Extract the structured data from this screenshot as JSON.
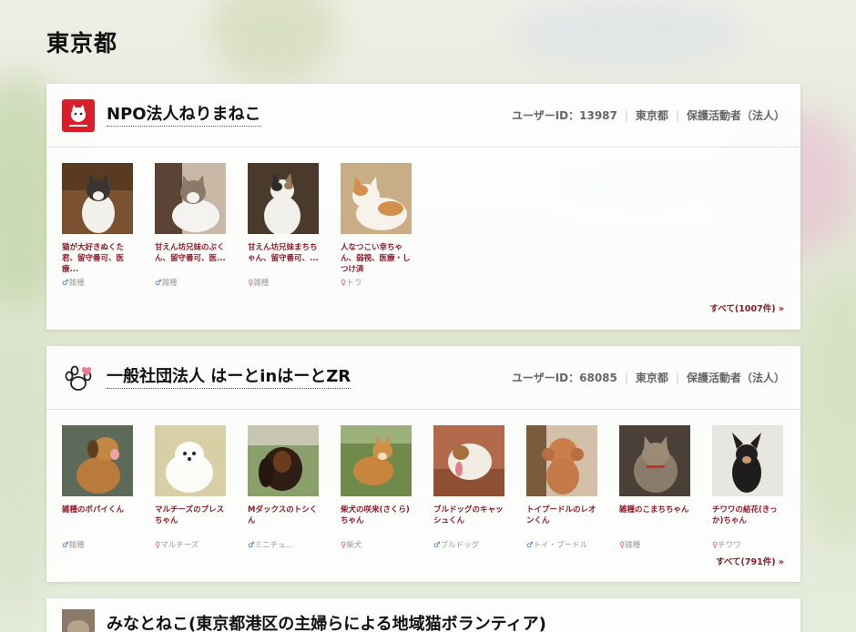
{
  "page": {
    "title": "東京都"
  },
  "orgs": [
    {
      "name": "NPO法人ねりまねこ",
      "user_id": "ユーザーID：13987",
      "area": "東京都",
      "type": "保護活動者（法人）",
      "all_link": "すべて(1007件) »",
      "icon": "nerimaneko-logo",
      "pets": [
        {
          "name": "猫が大好きぬくた君、留守番可、医療...",
          "sex": "♂",
          "breed": "雑種"
        },
        {
          "name": "甘えん坊兄妹のぶくん、留守番可、医...",
          "sex": "♂",
          "breed": "雑種"
        },
        {
          "name": "甘えん坊兄妹まちちゃん、留守番可、...",
          "sex": "♀",
          "breed": "雑種"
        },
        {
          "name": "人なつこい幸ちゃん、弱視、医療・しつけ済",
          "sex": "♀",
          "breed": "トラ"
        }
      ]
    },
    {
      "name": "一般社団法人 はーとinはーとZR",
      "user_id": "ユーザーID：68085",
      "area": "東京都",
      "type": "保護活動者（法人）",
      "all_link": "すべて(791件) »",
      "icon": "paw-heart-icon",
      "pets": [
        {
          "name": "雑種のポパイくん",
          "sex": "♂",
          "breed": "雑種"
        },
        {
          "name": "マルチーズのプレスちゃん",
          "sex": "♀",
          "breed": "マルチーズ"
        },
        {
          "name": "Mダックスのトシくん",
          "sex": "♂",
          "breed": "ミニチュ..."
        },
        {
          "name": "柴犬の咲来(さくら)ちゃん",
          "sex": "♀",
          "breed": "柴犬"
        },
        {
          "name": "ブルドッグのキャッシュくん",
          "sex": "♂",
          "breed": "ブルドッグ"
        },
        {
          "name": "トイプードルのレオンくん",
          "sex": "♂",
          "breed": "トイ・プードル"
        },
        {
          "name": "雑種のこまちちゃん",
          "sex": "♀",
          "breed": "雑種"
        },
        {
          "name": "チワワの結花(きっか)ちゃん",
          "sex": "♀",
          "breed": "チワワ"
        }
      ]
    },
    {
      "name": "みなとねこ(東京都港区の主婦らによる地域猫ボランティア)"
    }
  ]
}
